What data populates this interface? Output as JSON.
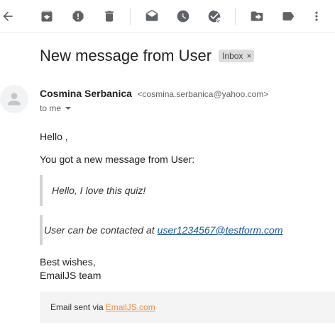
{
  "toolbar": {
    "icons": [
      "back-arrow-icon",
      "archive-icon",
      "report-spam-icon",
      "delete-icon",
      "mark-unread-icon",
      "snooze-icon",
      "add-to-tasks-icon",
      "move-to-icon",
      "labels-icon",
      "more-vert-icon"
    ]
  },
  "message": {
    "subject": "New message from User",
    "label": "Inbox",
    "label_remove": "×",
    "sender_name": "Cosmina Serbanica",
    "sender_email": "<cosmina.serbanica@yahoo.com>",
    "to_text": "to me",
    "greeting": "Hello ,",
    "intro": "You got a new message from User:",
    "quote_message": "Hello, I love this quiz!",
    "contact_prefix": "User can be contacted at",
    "contact_email": "user1234567@testform.com",
    "signoff_line1": "Best wishes,",
    "signoff_line2": "EmailJS team",
    "footer_prefix": "Email sent via",
    "footer_link": "EmailJS.com"
  },
  "colors": {
    "icon_gray": "#5f6368",
    "link_blue": "#1a56a8",
    "footer_link_orange": "#f48c3c",
    "chip_bg": "#dddddd",
    "footer_bg": "#f4f4f4",
    "quote_border": "#d3d3d3"
  }
}
